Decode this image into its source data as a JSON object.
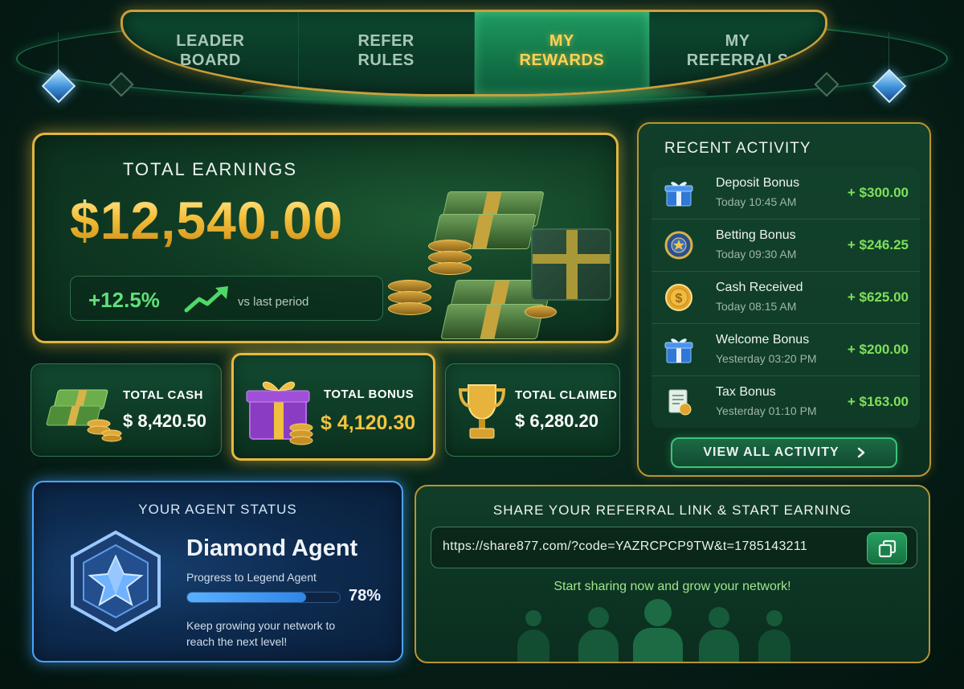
{
  "nav": {
    "tabs": [
      {
        "label": "LEADER\nBOARD",
        "active": false
      },
      {
        "label": "REFER\nRULES",
        "active": false
      },
      {
        "label": "MY\nREWARDS",
        "active": true
      },
      {
        "label": "MY\nREFERRALS",
        "active": false
      }
    ]
  },
  "earnings": {
    "title": "TOTAL EARNINGS",
    "amount": "$12,540.00",
    "growth": "+12.5%",
    "growth_note": "vs last period"
  },
  "stats": {
    "cash": {
      "label": "TOTAL CASH",
      "value": "$ 8,420.50"
    },
    "bonus": {
      "label": "TOTAL BONUS",
      "value": "$ 4,120.30"
    },
    "claimed": {
      "label": "TOTAL CLAIMED",
      "value": "$ 6,280.20"
    }
  },
  "activity": {
    "title": "RECENT ACTIVITY",
    "items": [
      {
        "name": "Deposit Bonus",
        "time": "Today 10:45 AM",
        "amount": "+ $300.00",
        "icon": "gift-icon"
      },
      {
        "name": "Betting Bonus",
        "time": "Today 09:30 AM",
        "amount": "+ $246.25",
        "icon": "chip-icon"
      },
      {
        "name": "Cash Received",
        "time": "Today 08:15 AM",
        "amount": "+ $625.00",
        "icon": "coin-icon"
      },
      {
        "name": "Welcome Bonus",
        "time": "Yesterday 03:20 PM",
        "amount": "+ $200.00",
        "icon": "gift-icon"
      },
      {
        "name": "Tax Bonus",
        "time": "Yesterday 01:10 PM",
        "amount": "+ $163.00",
        "icon": "document-icon"
      }
    ],
    "button_label": "VIEW ALL ACTIVITY",
    "button_icon": "chevron-right-icon"
  },
  "agent": {
    "title": "YOUR AGENT STATUS",
    "name": "Diamond Agent",
    "progress_label": "Progress to Legend Agent",
    "progress": 0.78,
    "progress_text": "78%",
    "description": "Keep growing your network to reach the next level!"
  },
  "referral": {
    "title": "SHARE YOUR REFERRAL LINK & START EARNING",
    "url": "https://share877.com/?code=YAZRCPCP9TW&t=1785143211",
    "cta": "Start sharing now and grow your network!",
    "copy_icon": "copy-icon"
  },
  "colors": {
    "gold": "#e1b53f",
    "green_accent": "#5fe07a",
    "blue_accent": "#4aa3ff",
    "amount_green": "#7ee05a"
  }
}
